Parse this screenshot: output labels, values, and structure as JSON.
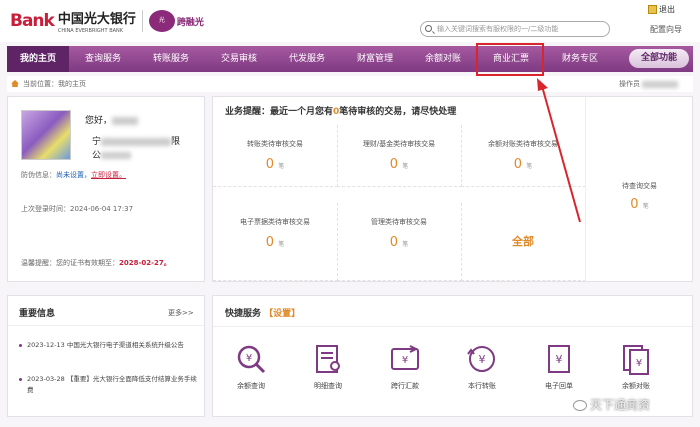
{
  "brand": {
    "bank": "Bank",
    "cn": "中国光大银行",
    "en": "CHINA EVERBRIGHT BANK",
    "sub_logo": "光",
    "sub_title": "跨融光"
  },
  "header": {
    "search_placeholder": "输入关键词搜索有服权限的一/二级功能",
    "logout": "退出",
    "help": "配置向导"
  },
  "nav": {
    "items": [
      "我的主页",
      "查询服务",
      "转账服务",
      "交易审核",
      "代发服务",
      "财富管理",
      "余额对账",
      "商业汇票",
      "财务专区"
    ],
    "active_index": 0,
    "all_label": "全部功能",
    "highlighted": "商业汇票"
  },
  "breadcrumb": {
    "label": "当前位置：我的主页",
    "right": "操作员"
  },
  "user": {
    "greeting": "您好，",
    "name_line1": "宁",
    "name_line2_end": "限",
    "name_line3": "公",
    "security_label": "防伪信息：",
    "security_value": "尚未设置，",
    "security_link": "立即设置。",
    "last_login_label": "上次登录时间：",
    "last_login_value": "2024-06-04 17:37",
    "cert_label": "温馨提醒：您的证书有效期至：",
    "cert_value": "2028-02-27。"
  },
  "business": {
    "title_prefix": "业务提醒：最近一个月您有",
    "title_count": "0",
    "title_suffix": "笔待审核的交易，请尽快处理",
    "cells": [
      {
        "label": "转账类待审核交易",
        "value": "0",
        "unit": "笔"
      },
      {
        "label": "理财/基金类待审核交易",
        "value": "0",
        "unit": "笔"
      },
      {
        "label": "余额对账类待审核交易",
        "value": "0",
        "unit": "笔"
      },
      {
        "label": "电子票据类待审核交易",
        "value": "0",
        "unit": "笔"
      },
      {
        "label": "管理类待审核交易",
        "value": "0",
        "unit": "笔"
      }
    ],
    "all_label": "全部",
    "pending": {
      "label": "待查询交易",
      "value": "0",
      "unit": "笔"
    }
  },
  "news": {
    "title": "重要信息",
    "more": "更多>>",
    "items": [
      {
        "text": "2023-12-13 中国光大银行电子渠道相关系统升级公告"
      },
      {
        "text": "2023-03-28 【重要】光大银行全面降低支付结算业务手续费"
      }
    ]
  },
  "quick": {
    "title": "快捷服务",
    "set": "【设置】",
    "items": [
      {
        "label": "余额查询",
        "icon": "balance-query-icon"
      },
      {
        "label": "明细查询",
        "icon": "detail-query-icon"
      },
      {
        "label": "跨行汇款",
        "icon": "interbank-remit-icon"
      },
      {
        "label": "本行转账",
        "icon": "intrabank-transfer-icon"
      },
      {
        "label": "电子回单",
        "icon": "e-receipt-icon"
      },
      {
        "label": "余额对账",
        "icon": "balance-reconcile-icon"
      }
    ]
  },
  "watermark": "天下通商资",
  "colors": {
    "brand_purple": "#7e3a82",
    "accent_orange": "#e08a2a",
    "highlight_red": "#d8262c"
  }
}
